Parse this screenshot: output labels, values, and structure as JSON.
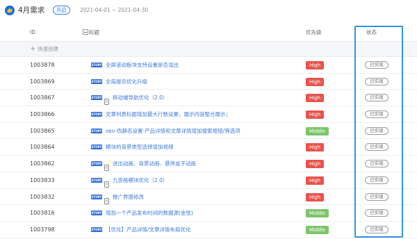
{
  "header": {
    "sprint_title": "4月需求",
    "status": "开启",
    "date_range": "2021-04-01 ~ 2021-04-30"
  },
  "columns": {
    "id": "ID",
    "title": "标题",
    "priority": "优先级",
    "status": "状态"
  },
  "quick_create": {
    "label": "快速创建"
  },
  "rows": [
    {
      "id": "1003878",
      "tag": "STORY",
      "sub": false,
      "title": "全屏滚动板块支持设置是否溢出",
      "priority": "High",
      "status": "已实现"
    },
    {
      "id": "1003869",
      "tag": "STORY",
      "sub": false,
      "title": "全局提示优化升级",
      "priority": "High",
      "status": "已实现"
    },
    {
      "id": "1003867",
      "tag": "STORY",
      "sub": true,
      "title": "移动端导航优化（2.0）",
      "priority": "High",
      "status": "已实现"
    },
    {
      "id": "1003866",
      "tag": "STORY",
      "sub": false,
      "title": "文章列表标题增加最大行数设置，展示内容整合展示；",
      "priority": "High",
      "status": "已实现"
    },
    {
      "id": "1003865",
      "tag": "STORY",
      "sub": false,
      "title": "seo-伪静态设置-产品详情和文章详情增加搜索按钮/筛选项",
      "priority": "Middle",
      "status": "已实现"
    },
    {
      "id": "1003864",
      "tag": "STORY",
      "sub": false,
      "title": "模块的背景类型选择增加视频",
      "priority": "High",
      "status": "已实现"
    },
    {
      "id": "1003862",
      "tag": "STORY",
      "sub": true,
      "title": "进出动画、背景动画、悬停盒子动画",
      "priority": "High",
      "status": "已实现"
    },
    {
      "id": "1003833",
      "tag": "STORY",
      "sub": true,
      "title": "九宫格模块优化（2.0）",
      "priority": "High",
      "status": "已实现"
    },
    {
      "id": "1003832",
      "tag": "STORY",
      "sub": true,
      "title": "推广界面修改",
      "priority": "High",
      "status": "已实现"
    },
    {
      "id": "1003816",
      "tag": "STORY",
      "sub": false,
      "title": "增加一个产品发布时间的数据源(金张)",
      "priority": "Middle",
      "status": "已实现"
    },
    {
      "id": "1003798",
      "tag": "STORY",
      "sub": false,
      "title": "【优化】产品详情/文章详情布局优化",
      "priority": "Middle",
      "status": "已实现"
    }
  ],
  "colors": {
    "accent": "#2b7de9",
    "high": "#e8534b",
    "middle": "#7dc56a",
    "highlight": "#2e93e6"
  }
}
